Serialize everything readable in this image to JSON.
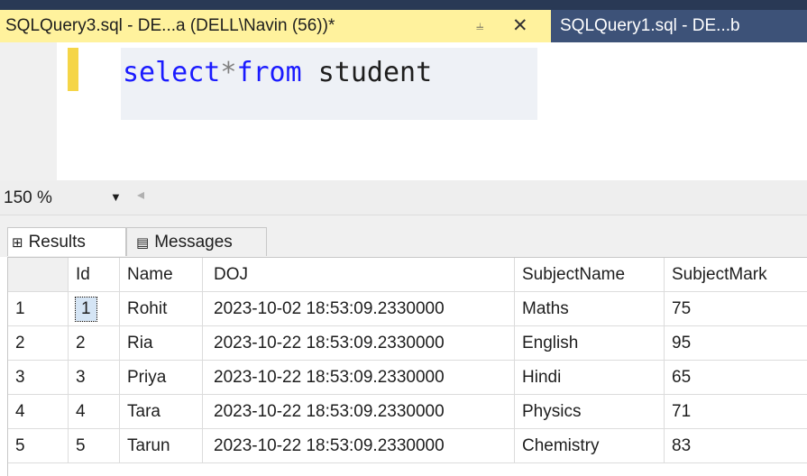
{
  "tabs": {
    "active": {
      "title": "SQLQuery3.sql - DE...a (DELL\\Navin (56))*",
      "pin_icon": "pin-icon",
      "close_icon": "close-icon"
    },
    "inactive": {
      "title": "SQLQuery1.sql - DE...b"
    }
  },
  "editor": {
    "tokens": [
      {
        "text": "select",
        "kind": "keyword"
      },
      {
        "text": "*",
        "kind": "operator"
      },
      {
        "text": "from",
        "kind": "keyword"
      },
      {
        "text": " student",
        "kind": "identifier"
      }
    ]
  },
  "zoom": {
    "value": "150 %",
    "dropdown_icon": "chevron-down-icon"
  },
  "results_tabs": {
    "results_label": "Results",
    "messages_label": "Messages"
  },
  "grid": {
    "columns": [
      "Id",
      "Name",
      "DOJ",
      "SubjectName",
      "SubjectMark"
    ],
    "rows": [
      {
        "num": "1",
        "Id": "1",
        "Name": "Rohit",
        "DOJ": "2023-10-02 18:53:09.2330000",
        "SubjectName": "Maths",
        "SubjectMark": "75"
      },
      {
        "num": "2",
        "Id": "2",
        "Name": "Ria",
        "DOJ": "2023-10-22 18:53:09.2330000",
        "SubjectName": "English",
        "SubjectMark": "95"
      },
      {
        "num": "3",
        "Id": "3",
        "Name": "Priya",
        "DOJ": "2023-10-22 18:53:09.2330000",
        "SubjectName": "Hindi",
        "SubjectMark": "65"
      },
      {
        "num": "4",
        "Id": "4",
        "Name": "Tara",
        "DOJ": "2023-10-22 18:53:09.2330000",
        "SubjectName": "Physics",
        "SubjectMark": "71"
      },
      {
        "num": "5",
        "Id": "5",
        "Name": "Tarun",
        "DOJ": "2023-10-22 18:53:09.2330000",
        "SubjectName": "Chemistry",
        "SubjectMark": "83"
      }
    ],
    "selected_cell": {
      "row": 0,
      "column": "Id"
    }
  },
  "colors": {
    "titlebar": "#293955",
    "active_tab": "#fff29d",
    "inactive_tab": "#3d5278",
    "keyword": "#1a1aff",
    "change_bar": "#f5d547",
    "selection": "#d5e5f5"
  }
}
